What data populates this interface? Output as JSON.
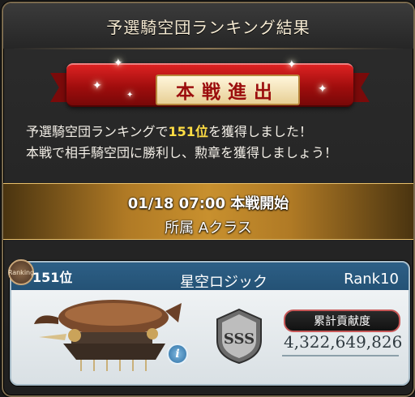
{
  "dialog": {
    "title": "予選騎空団ランキング結果"
  },
  "ribbon": {
    "label": "本戦進出"
  },
  "message": {
    "line1_prefix": "予選騎空団ランキングで",
    "line1_highlight": "151位",
    "line1_suffix": "を獲得しました！",
    "line2": "本戦で相手騎空団に勝利し、勲章を獲得しましょう！"
  },
  "band": {
    "schedule": "01/18 07:00 本戦開始",
    "class": "所属 Aクラス"
  },
  "crew": {
    "badge_label": "Ranking",
    "rank": "151位",
    "name": "星空ロジック",
    "crew_rank": "Rank10",
    "grade": "SSS",
    "contribution_label": "累計貢献度",
    "contribution_value": "4,322,649,826"
  },
  "colors": {
    "highlight": "#ffdd44",
    "ribbon_red": "#b01010",
    "card_topbar": "#2d5f86"
  },
  "icons": {
    "info": "info-icon",
    "sparkle": "sparkle-icon",
    "emblem": "sss-emblem-icon",
    "airship": "airship-illustration"
  }
}
